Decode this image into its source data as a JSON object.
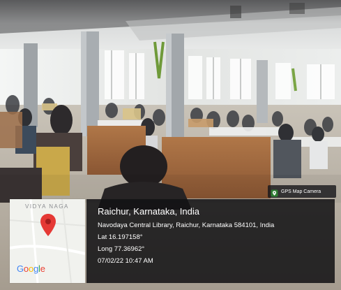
{
  "overlay": {
    "app_tag": "GPS Map Camera",
    "map": {
      "place_label": "VIDYA NAGA",
      "logo_parts": [
        "G",
        "o",
        "o",
        "g",
        "l",
        "e"
      ]
    },
    "location_title": "Raichur, Karnataka, India",
    "address": "Navodaya Central Library, Raichur, Karnataka 584101, India",
    "latitude": "Lat 16.197158°",
    "longitude": "Long 77.36962°",
    "datetime": "07/02/22 10:47 AM"
  },
  "scene": {
    "subject": "reading hall with students seated at desks",
    "colors": {
      "ceiling": "#eceeee",
      "floor": "#bcb4a7",
      "desk_wood": "#a4693f",
      "pin_red": "#e53935"
    }
  }
}
